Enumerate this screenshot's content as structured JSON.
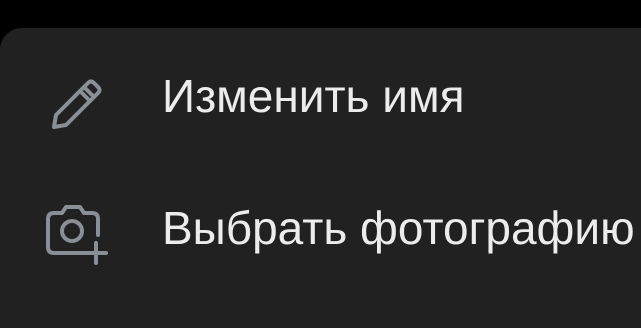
{
  "menu": {
    "items": [
      {
        "label": "Изменить имя",
        "icon": "pencil-icon"
      },
      {
        "label": "Выбрать фотографию",
        "icon": "camera-add-icon"
      }
    ]
  },
  "colors": {
    "background": "#000000",
    "menu_background": "#212121",
    "icon": "#8a8f96",
    "text": "#ececec"
  }
}
